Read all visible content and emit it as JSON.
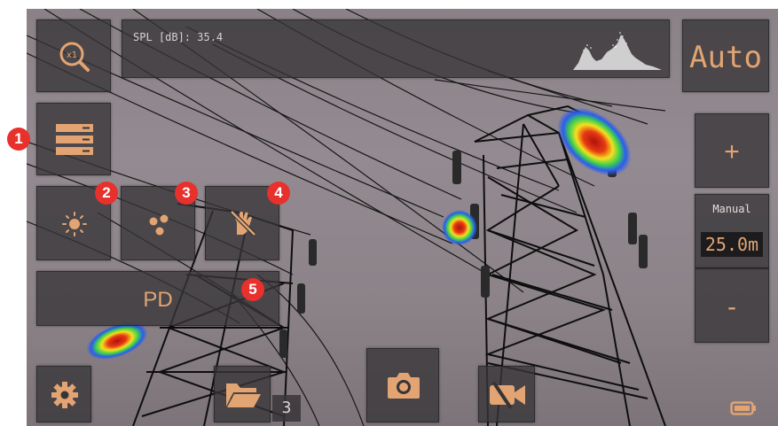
{
  "spl": {
    "text": "SPL [dB]: 35.4"
  },
  "mode": {
    "label": "Auto"
  },
  "pd_button": {
    "label": "PD"
  },
  "range": {
    "mode_label": "Manual",
    "value": "25.0m",
    "increase_label": "+",
    "decrease_label": "-"
  },
  "gallery": {
    "count": "3"
  },
  "badges": [
    "1",
    "2",
    "3",
    "4",
    "5"
  ],
  "icons": {
    "zoom": "zoom-x1-icon",
    "menu": "menu-list-icon",
    "brightness": "brightness-icon",
    "dots": "dots-icon",
    "filter": "hand-off-icon",
    "settings": "gear-icon",
    "folder": "folder-icon",
    "camera": "camera-icon",
    "video": "video-off-icon",
    "battery": "battery-icon"
  },
  "colors": {
    "accent": "#e2a472",
    "badge": "#e8302c",
    "panel": "#373437"
  }
}
